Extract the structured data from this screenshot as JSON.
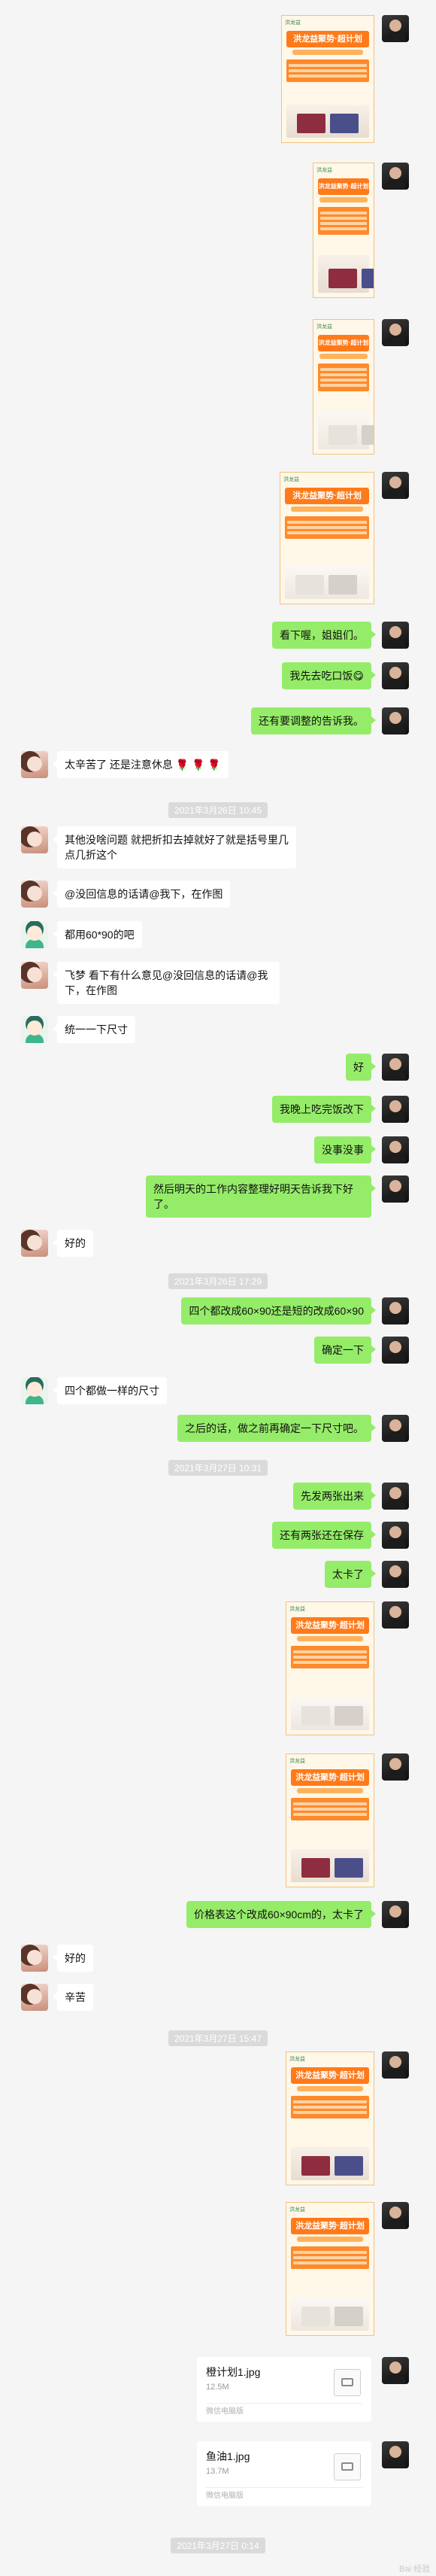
{
  "messages": {
    "m1": "看下喔，姐姐们。",
    "m2": "我先去吃口饭😋",
    "m3": "还有要调整的告诉我。",
    "m4": "太辛苦了 还是注意休息 🌹 🌹 🌹",
    "m5": "其他没啥问题 就把折扣去掉就好了就是括号里几点几折这个",
    "m6": "@没回信息的话请@我下，在作图",
    "m7": "都用60*90的吧",
    "m8": "飞梦 看下有什么意见@没回信息的话请@我下，在作图",
    "m9": "统一一下尺寸",
    "m10": "好",
    "m11": "我晚上吃完饭改下",
    "m12": "没事没事",
    "m13": "然后明天的工作内容整理好明天告诉我下好了。",
    "m14": "好的",
    "m15": "四个都改成60×90还是短的改成60×90",
    "m16": "确定一下",
    "m17": "四个都做一样的尺寸",
    "m18": "之后的话，做之前再确定一下尺寸吧。",
    "m19": "先发两张出来",
    "m20": "还有两张还在保存",
    "m21": "太卡了",
    "m22": "价格表这个改成60×90cm的，太卡了",
    "m23": "好的",
    "m24": "辛苦"
  },
  "times": {
    "t1": "2021年3月26日 10:45",
    "t2": "2021年3月26日 17:29",
    "t3": "2021年3月27日 10:31",
    "t4": "2021年3月27日 15:47",
    "t5": "2021年3月27日 0:14"
  },
  "poster": {
    "title": "洪龙益聚势·超计划",
    "brand": "洪龙益"
  },
  "files": [
    {
      "name": "橙计划1.jpg",
      "size": "12.5M",
      "source": "微信电脑版"
    },
    {
      "name": "鱼油1.jpg",
      "size": "13.7M",
      "source": "微信电脑版"
    }
  ],
  "watermark": "Bai 经验"
}
